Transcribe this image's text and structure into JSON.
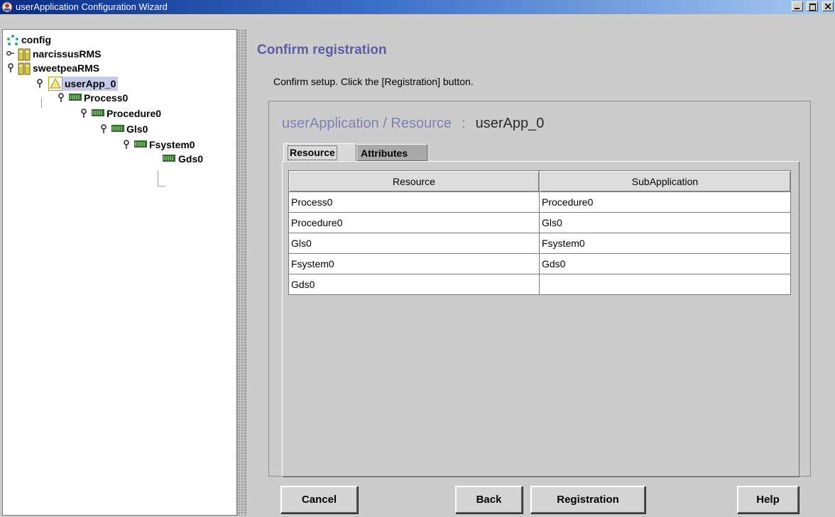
{
  "window": {
    "title": "userApplication Configuration Wizard",
    "controls": [
      "minimize",
      "maximize",
      "close"
    ]
  },
  "tree": {
    "items": [
      {
        "label": "config",
        "icon": "cluster-config-icon"
      },
      {
        "label": "narcissusRMS",
        "icon": "rms-node-icon"
      },
      {
        "label": "sweetpeaRMS",
        "icon": "rms-node-icon"
      },
      {
        "label": "userApp_0",
        "icon": "warning-triangle-icon",
        "selected": true
      },
      {
        "label": "Process0",
        "icon": "resource-chip-icon"
      },
      {
        "label": "Procedure0",
        "icon": "resource-chip-icon"
      },
      {
        "label": "Gls0",
        "icon": "resource-chip-icon"
      },
      {
        "label": "Fsystem0",
        "icon": "resource-chip-icon"
      },
      {
        "label": "Gds0",
        "icon": "resource-chip-icon"
      }
    ]
  },
  "main": {
    "heading": "Confirm registration",
    "instruction": "Confirm setup.  Click the [Registration] button.",
    "caption_label": "userApplication / Resource",
    "caption_separator": ":",
    "caption_value": "userApp_0",
    "tabs": [
      {
        "label": "Resource",
        "active": true
      },
      {
        "label": "Attributes",
        "active": false
      }
    ],
    "table": {
      "columns": [
        "Resource",
        "SubApplication"
      ],
      "rows": [
        [
          "Process0",
          "Procedure0"
        ],
        [
          "Procedure0",
          "Gls0"
        ],
        [
          "Gls0",
          "Fsystem0"
        ],
        [
          "Fsystem0",
          "Gds0"
        ],
        [
          "Gds0",
          ""
        ]
      ]
    }
  },
  "buttons": {
    "cancel": "Cancel",
    "back": "Back",
    "registration": "Registration",
    "help": "Help"
  },
  "colors": {
    "title_gradient_start": "#0a2c86",
    "heading": "#5a5ea6",
    "selection": "#c6c9e8",
    "background": "#cccccc"
  }
}
